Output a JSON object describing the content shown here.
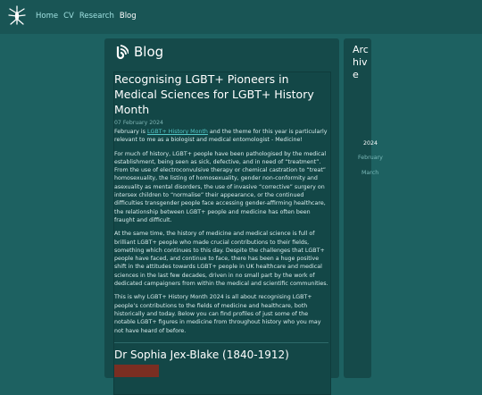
{
  "nav": {
    "items": [
      {
        "label": "Home"
      },
      {
        "label": "CV"
      },
      {
        "label": "Research"
      },
      {
        "label": "Blog"
      }
    ]
  },
  "blog": {
    "heading": "Blog",
    "post": {
      "title": "Recognising LGBT+ Pioneers in Medical Sciences for LGBT+ History Month",
      "date": "07 February 2024",
      "p1_before": "February is ",
      "p1_link": "LGBT+ History Month",
      "p1_after": " and the theme for this year is particularly relevant to me as a biologist and medical entomologist - Medicine!",
      "p2": "For much of history, LGBT+ people have been pathologised by the medical establishment, being seen as sick, defective, and in need of “treatment”. From the use of electroconvulsive therapy or chemical castration to “treat” homosexuality, the listing of homosexuality, gender non-conformity and asexuality as mental disorders, the use of invasive “corrective” surgery on intersex children to “normalise” their appearance, or the continued difficulties transgender people face accessing gender-affirming healthcare, the relationship between LGBT+ people and medicine has often been fraught and difficult.",
      "p3": "At the same time, the history of medicine and medical science is full of brilliant LGBT+ people who made crucial contributions to their fields, something which continues to this day. Despite the challenges that LGBT+ people have faced, and continue to face, there has been a huge positive shift in the attitudes towards LGBT+ people in UK healthcare and medical sciences in the last few decades, driven in no small part by the work of dedicated campaigners from within the medical and scientific communities.",
      "p4": "This is why LGBT+ History Month 2024 is all about recognising LGBT+ people’s contributions to the fields of medicine and healthcare, both historically and today. Below you can find profiles of just some of the notable LGBT+ figures in medicine from throughout history who you may not have heard of before.",
      "subheading": "Dr Sophia Jex-Blake (1840-1912)"
    }
  },
  "archive": {
    "heading": "Archive",
    "year": "2024",
    "months": [
      "February",
      "March"
    ]
  },
  "colors": {
    "background": "#1d6161",
    "panel": "#154a4a",
    "link": "#53c6c6",
    "nav_link": "#9fe0e0"
  }
}
